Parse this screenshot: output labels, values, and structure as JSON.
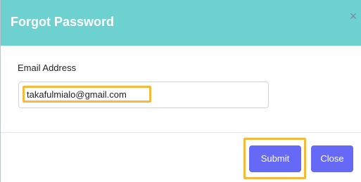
{
  "dialog": {
    "title": "Forgot Password",
    "close_icon": "close-icon",
    "close_glyph": "×"
  },
  "form": {
    "email_label": "Email Address",
    "email_value": "takafulmialo@gmail.com"
  },
  "footer": {
    "submit_label": "Submit",
    "close_label": "Close"
  },
  "colors": {
    "header_bg": "#6dd1cf",
    "button_bg": "#6669f6",
    "highlight": "#f6b93b"
  }
}
